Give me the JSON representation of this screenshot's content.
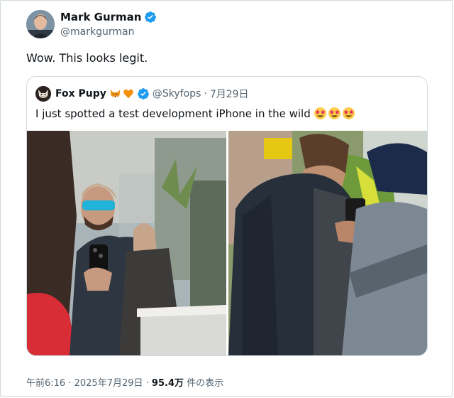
{
  "author": {
    "name": "Mark Gurman",
    "handle": "@markgurman",
    "verified": true
  },
  "tweet": {
    "text": "Wow. This looks legit."
  },
  "quote": {
    "name": "Fox Pupy",
    "name_emojis": [
      "fox-face",
      "orange-heart"
    ],
    "verified": true,
    "handle": "@Skyfops",
    "separator": "·",
    "date": "7月29日",
    "text": "I just spotted a test development iPhone in the wild",
    "text_emojis": [
      "star-struck",
      "star-struck",
      "star-struck"
    ],
    "media": [
      {
        "label": "photo-man-in-cap-with-iphone"
      },
      {
        "label": "photo-man-in-vest-holding-iphone"
      }
    ]
  },
  "footer": {
    "time": "午前6:16",
    "separator1": " · ",
    "date": "2025年7月29日",
    "separator2": " · ",
    "views_count": "95.4万",
    "views_label": " 件の表示"
  },
  "colors": {
    "verified_blue": "#1d9bf0",
    "secondary_text": "#536471",
    "border": "#cfd9de"
  }
}
